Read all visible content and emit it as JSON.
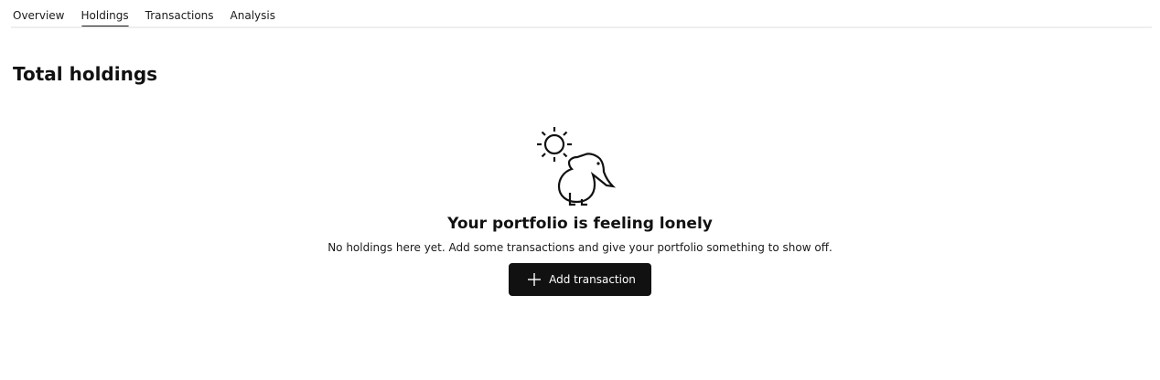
{
  "tabs": [
    {
      "label": "Overview",
      "active": false
    },
    {
      "label": "Holdings",
      "active": true
    },
    {
      "label": "Transactions",
      "active": false
    },
    {
      "label": "Analysis",
      "active": false
    }
  ],
  "page": {
    "title": "Total holdings"
  },
  "empty_state": {
    "illustration": "sun-and-kiwi-bird-icon",
    "title": "Your portfolio is feeling lonely",
    "text": "No holdings here yet. Add some transactions and give your portfolio something to show off.",
    "button": {
      "icon": "plus-icon",
      "label": "Add transaction"
    }
  },
  "colors": {
    "text": "#111111",
    "button_bg": "#111111",
    "button_text": "#ffffff",
    "divider": "#eeeeee"
  }
}
